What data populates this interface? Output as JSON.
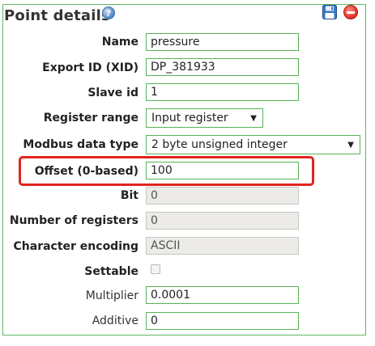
{
  "header": {
    "title": "Point details"
  },
  "fields": {
    "name": {
      "label": "Name",
      "value": "pressure"
    },
    "xid": {
      "label": "Export ID (XID)",
      "value": "DP_381933"
    },
    "slave_id": {
      "label": "Slave id",
      "value": "1"
    },
    "register_range": {
      "label": "Register range",
      "value": "Input register"
    },
    "data_type": {
      "label": "Modbus data type",
      "value": "2 byte unsigned integer"
    },
    "offset": {
      "label": "Offset (0-based)",
      "value": "100"
    },
    "bit": {
      "label": "Bit",
      "value": "0"
    },
    "num_registers": {
      "label": "Number of registers",
      "value": "0"
    },
    "char_encoding": {
      "label": "Character encoding",
      "value": "ASCII"
    },
    "settable": {
      "label": "Settable",
      "checked": false
    },
    "multiplier": {
      "label": "Multiplier",
      "value": "0.0001"
    },
    "additive": {
      "label": "Additive",
      "value": "0"
    }
  },
  "icons": {
    "help": "help-icon",
    "save": "save-icon",
    "delete": "delete-icon",
    "dropdown": "dropdown-arrow-icon"
  },
  "colors": {
    "border_green": "#57b357",
    "highlight_red": "#e3231d"
  }
}
